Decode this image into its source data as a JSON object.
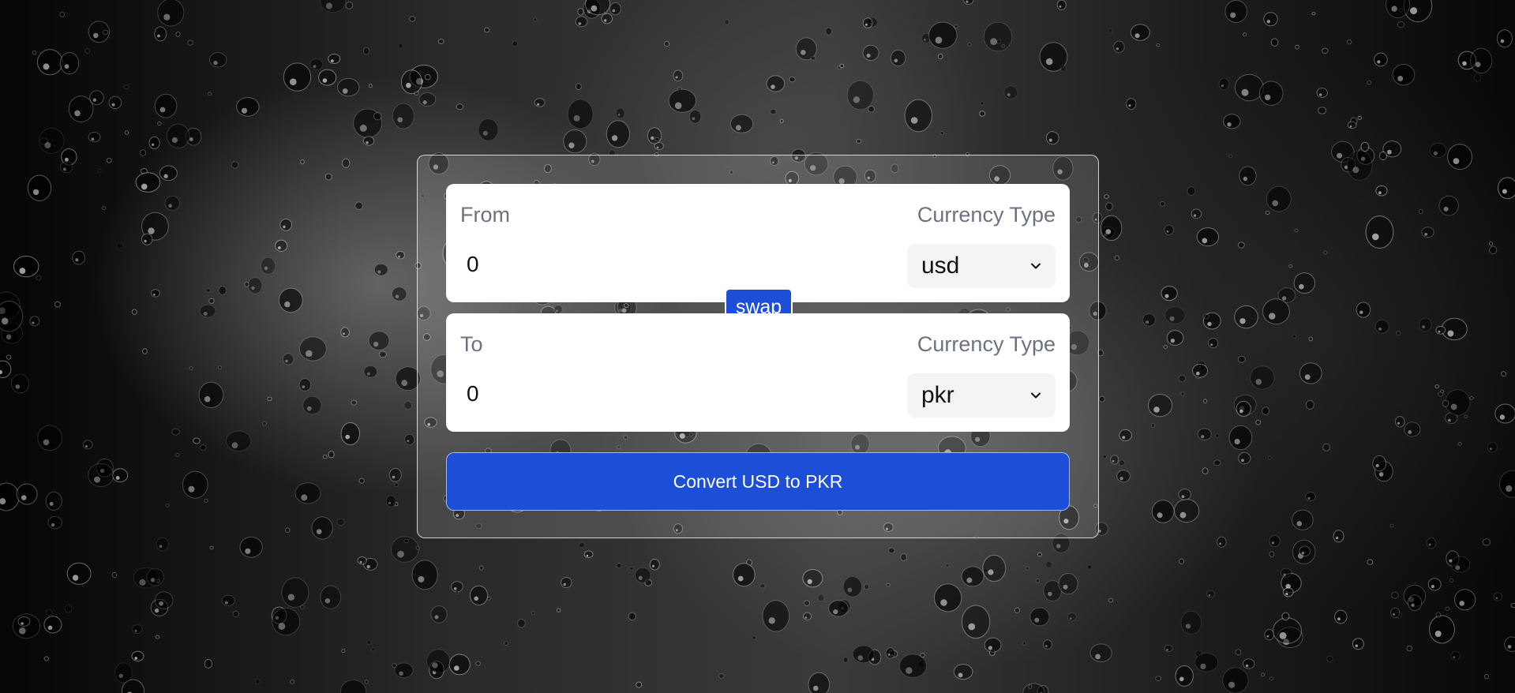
{
  "converter": {
    "from": {
      "label": "From",
      "currency_label": "Currency Type",
      "amount": "0",
      "currency": "usd"
    },
    "swap_label": "swap",
    "to": {
      "label": "To",
      "currency_label": "Currency Type",
      "amount": "0",
      "currency": "pkr"
    },
    "convert_label": "Convert USD to PKR"
  },
  "colors": {
    "primary_button": "#1d4ed8",
    "panel_background": "#ffffff",
    "select_background": "#f3f4f6",
    "label_text": "#6b7280"
  }
}
